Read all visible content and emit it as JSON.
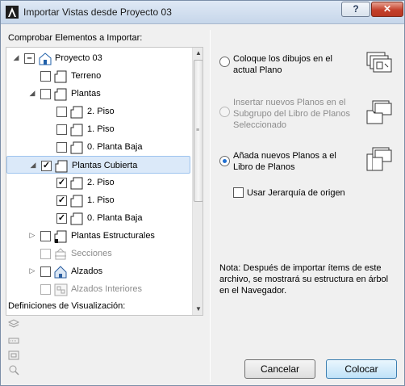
{
  "window": {
    "title": "Importar Vistas desde Proyecto 03",
    "help_label": "?",
    "close_label": "✕"
  },
  "left": {
    "section_label": "Comprobar Elementos a Importar:",
    "tree": [
      {
        "label": "Proyecto 03",
        "level": 0,
        "expander": "expanded",
        "check": "partial",
        "icon": "project-icon",
        "disabled": false,
        "selected": false
      },
      {
        "label": "Terreno",
        "level": 1,
        "expander": "none",
        "check": "unchecked",
        "icon": "floor-plan-icon",
        "disabled": false,
        "selected": false
      },
      {
        "label": "Plantas",
        "level": 1,
        "expander": "expanded",
        "check": "unchecked",
        "icon": "floor-plan-icon",
        "disabled": false,
        "selected": false
      },
      {
        "label": "2. Piso",
        "level": 2,
        "expander": "none",
        "check": "unchecked",
        "icon": "floor-plan-icon",
        "disabled": false,
        "selected": false
      },
      {
        "label": "1. Piso",
        "level": 2,
        "expander": "none",
        "check": "unchecked",
        "icon": "floor-plan-icon",
        "disabled": false,
        "selected": false
      },
      {
        "label": "0. Planta Baja",
        "level": 2,
        "expander": "none",
        "check": "unchecked",
        "icon": "floor-plan-icon",
        "disabled": false,
        "selected": false
      },
      {
        "label": "Plantas Cubierta",
        "level": 1,
        "expander": "expanded",
        "check": "checked",
        "icon": "floor-plan-icon",
        "disabled": false,
        "selected": true
      },
      {
        "label": "2. Piso",
        "level": 2,
        "expander": "none",
        "check": "checked",
        "icon": "floor-plan-icon",
        "disabled": false,
        "selected": false
      },
      {
        "label": "1. Piso",
        "level": 2,
        "expander": "none",
        "check": "checked",
        "icon": "floor-plan-icon",
        "disabled": false,
        "selected": false
      },
      {
        "label": "0. Planta Baja",
        "level": 2,
        "expander": "none",
        "check": "checked",
        "icon": "floor-plan-icon",
        "disabled": false,
        "selected": false
      },
      {
        "label": "Plantas Estructurales",
        "level": 1,
        "expander": "collapsed",
        "check": "unchecked",
        "icon": "structural-plan-icon",
        "disabled": false,
        "selected": false
      },
      {
        "label": "Secciones",
        "level": 1,
        "expander": "none",
        "check": "unchecked",
        "icon": "section-icon",
        "disabled": true,
        "selected": false
      },
      {
        "label": "Alzados",
        "level": 1,
        "expander": "collapsed",
        "check": "unchecked",
        "icon": "elevation-icon",
        "disabled": false,
        "selected": false
      },
      {
        "label": "Alzados Interiores",
        "level": 1,
        "expander": "none",
        "check": "unchecked",
        "icon": "interior-elevation-icon",
        "disabled": true,
        "selected": false
      }
    ],
    "definitions_label": "Definiciones de Visualización:",
    "definition_icons": [
      "layers-icon",
      "dimension-icon",
      "frame-icon",
      "zoom-icon"
    ]
  },
  "right": {
    "options": [
      {
        "label": "Coloque los dibujos en el actual Plano",
        "state": "off",
        "disabled": false,
        "icon": "place-drawings-icon"
      },
      {
        "label": "Insertar nuevos Planos en el Subgrupo del Libro de Planos Seleccionado",
        "state": "off",
        "disabled": true,
        "icon": "insert-subset-icon"
      },
      {
        "label": "Añada nuevos Planos a el Libro de Planos",
        "state": "on",
        "disabled": false,
        "icon": "add-layouts-icon"
      }
    ],
    "hierarchy_checkbox": {
      "label": "Usar Jerarquía de origen",
      "checked": false
    },
    "note": "Nota: Después de importar ítems de este archivo, se mostrará su estructura en árbol en el Navegador."
  },
  "buttons": {
    "cancel_label": "Cancelar",
    "place_label": "Colocar"
  }
}
